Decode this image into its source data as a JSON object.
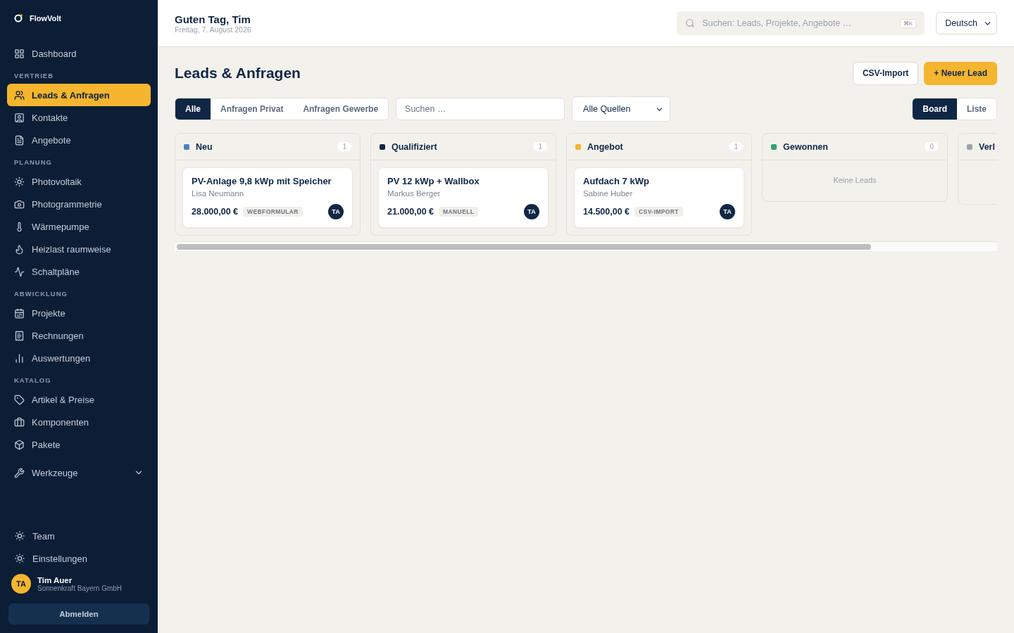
{
  "brand": {
    "name": "FlowVolt"
  },
  "sidebar": {
    "top_items": [
      {
        "label": "Dashboard",
        "selected": false
      }
    ],
    "sections": [
      {
        "title": "VERTRIEB",
        "items": [
          {
            "label": "Leads & Anfragen",
            "selected": true
          },
          {
            "label": "Kontakte",
            "selected": false
          },
          {
            "label": "Angebote",
            "selected": false
          }
        ]
      },
      {
        "title": "PLANUNG",
        "items": [
          {
            "label": "Photovoltaik",
            "selected": false
          },
          {
            "label": "Photogrammetrie",
            "selected": false
          },
          {
            "label": "Wärmepumpe",
            "selected": false
          },
          {
            "label": "Heizlast raumweise",
            "selected": false
          },
          {
            "label": "Schaltpläne",
            "selected": false
          }
        ]
      },
      {
        "title": "ABWICKLUNG",
        "items": [
          {
            "label": "Projekte",
            "selected": false
          },
          {
            "label": "Rechnungen",
            "selected": false
          },
          {
            "label": "Auswertungen",
            "selected": false
          }
        ]
      },
      {
        "title": "KATALOG",
        "items": [
          {
            "label": "Artikel & Preise",
            "selected": false
          },
          {
            "label": "Komponenten",
            "selected": false
          },
          {
            "label": "Pakete",
            "selected": false
          }
        ]
      }
    ],
    "tools": {
      "label": "Werkzeuge",
      "expanded": false
    },
    "bottom_items": [
      {
        "label": "Team"
      },
      {
        "label": "Einstellungen"
      }
    ],
    "user": {
      "initials": "TA",
      "name": "Tim Auer",
      "company": "Sonnenkraft Bayern GmbH"
    },
    "logout": "Abmelden"
  },
  "header": {
    "greeting": "Guten Tag, Tim",
    "date": "Freitag, 7. August 2026",
    "search": {
      "placeholder": "Suchen: Leads, Projekte, Angebote …",
      "shortcut": "⌘K"
    },
    "language": "Deutsch"
  },
  "page": {
    "title": "Leads & Anfragen",
    "buttons": [
      {
        "label": "CSV-Import",
        "kind": "secondary"
      },
      {
        "label": "+ Neuer Lead",
        "kind": "primary"
      }
    ]
  },
  "filters": {
    "tabs": [
      {
        "label": "Alle",
        "selected": true
      },
      {
        "label": "Anfragen Privat",
        "selected": false
      },
      {
        "label": "Anfragen Gewerbe",
        "selected": false
      }
    ],
    "search": {
      "placeholder": "Suchen …"
    },
    "source": "Alle Quellen",
    "views": [
      {
        "label": "Board",
        "selected": true
      },
      {
        "label": "Liste",
        "selected": false
      }
    ]
  },
  "board": {
    "columns": [
      {
        "title": "Neu",
        "color": "#4a7fc1",
        "count": "1",
        "cards": [
          {
            "title": "PV-Anlage 9,8 kWp mit Speicher",
            "customer": "Lisa Neumann",
            "amount": "28.000,00 €",
            "source": "WEBFORMULAR",
            "owner": "TA"
          }
        ]
      },
      {
        "title": "Qualifiziert",
        "color": "#0f2744",
        "count": "1",
        "cards": [
          {
            "title": "PV 12 kWp + Wallbox",
            "customer": "Markus Berger",
            "amount": "21.000,00 €",
            "source": "MANUELL",
            "owner": "TA"
          }
        ]
      },
      {
        "title": "Angebot",
        "color": "#f5b52e",
        "count": "1",
        "cards": [
          {
            "title": "Aufdach 7 kWp",
            "customer": "Sabine Huber",
            "amount": "14.500,00 €",
            "source": "CSV-IMPORT",
            "owner": "TA"
          }
        ]
      },
      {
        "title": "Gewonnen",
        "color": "#2fa36b",
        "count": "0",
        "empty": "Keine Leads"
      },
      {
        "title": "Verl",
        "color": "#9aa3ad"
      }
    ]
  }
}
